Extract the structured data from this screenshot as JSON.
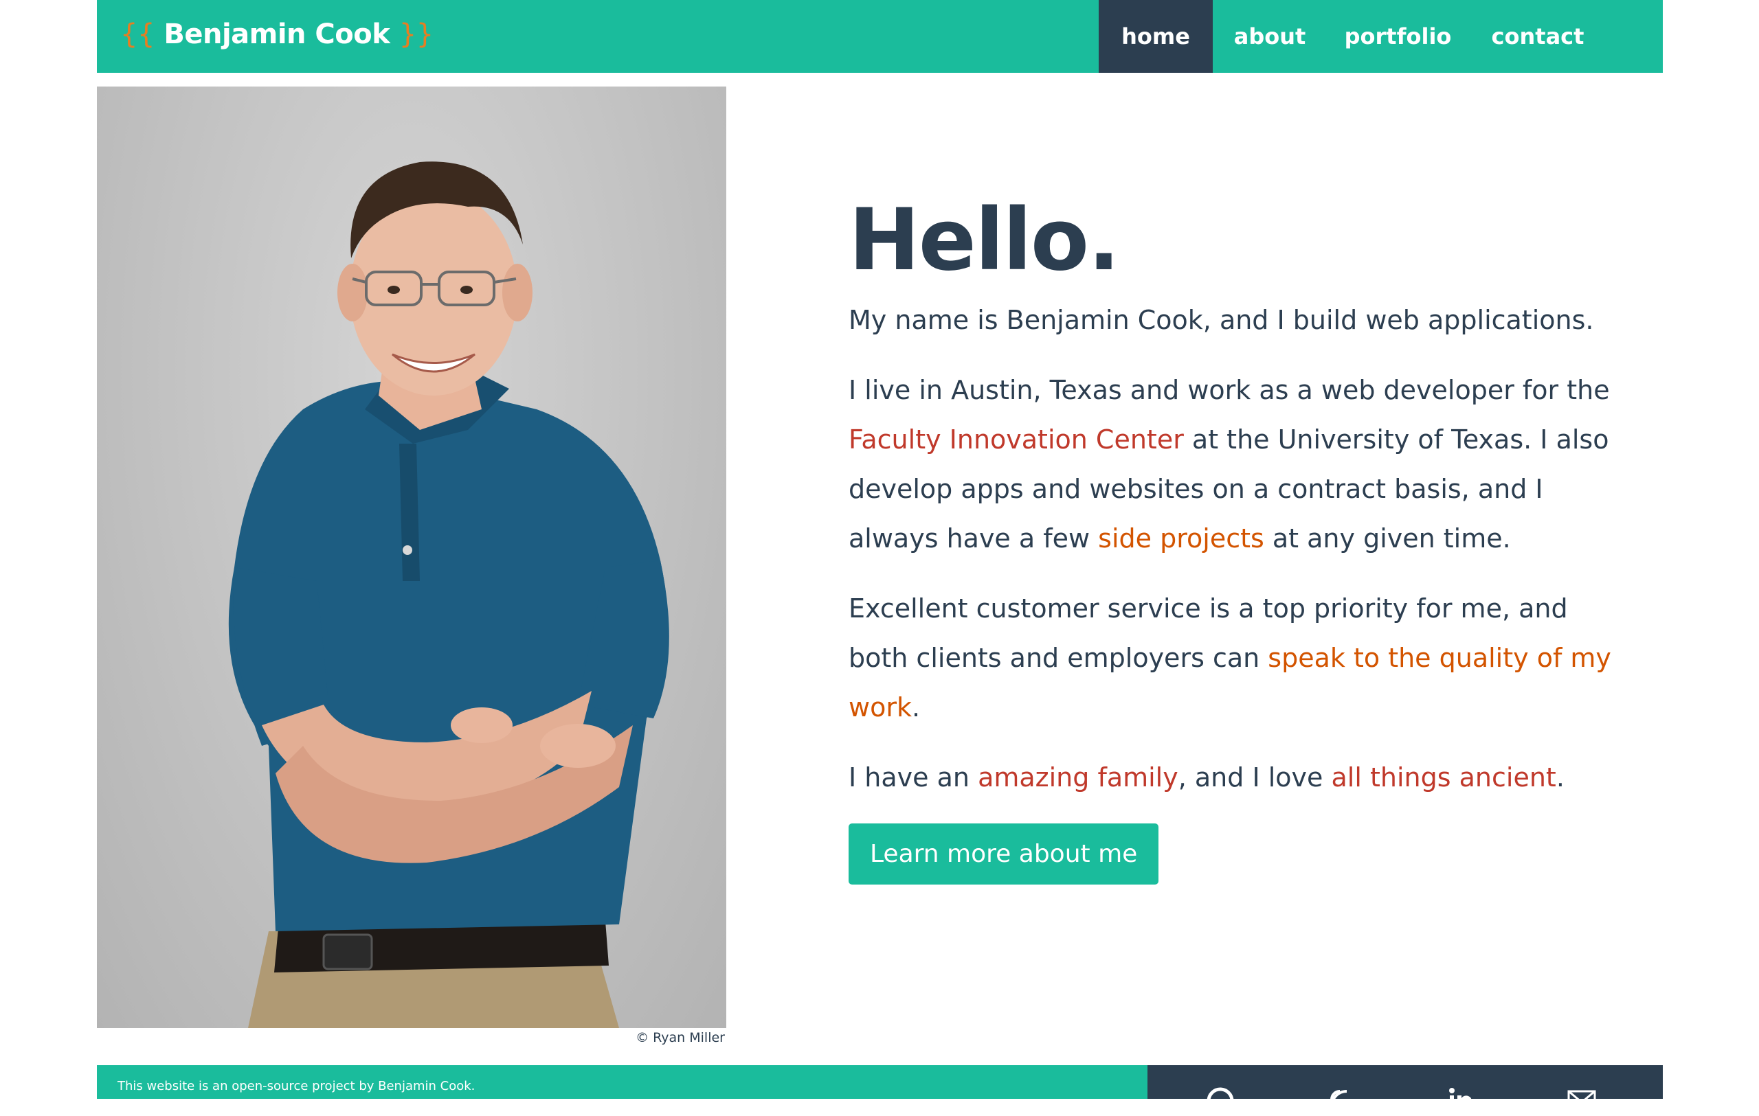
{
  "header": {
    "brand_open": "{{",
    "brand_name": "Benjamin Cook",
    "brand_close": "}}",
    "nav": {
      "home": "home",
      "about": "about",
      "portfolio": "portfolio",
      "contact": "contact"
    }
  },
  "photo": {
    "credit": "© Ryan Miller"
  },
  "intro": {
    "heading": "Hello.",
    "lead": "My name is Benjamin Cook, and I build web applications.",
    "p2_a": "I live in Austin, Texas and work as a web developer for the ",
    "p2_link1": "Faculty Innovation Center",
    "p2_b": " at the University of Texas. I also develop apps and websites on a contract basis, and I always have a few ",
    "p2_link2": "side projects",
    "p2_c": " at any given time.",
    "p3_a": "Excellent customer service is a top priority for me, and both clients and employers can ",
    "p3_link": "speak to the quality of my work",
    "p3_b": ".",
    "p4_a": "I have an ",
    "p4_link1": "amazing family",
    "p4_b": ", and I love ",
    "p4_link2": "all things ancient",
    "p4_c": ".",
    "button": "Learn more about me"
  },
  "footer": {
    "text": "This website is an open-source project by Benjamin Cook.",
    "social_icons": [
      "github-icon",
      "rss-icon",
      "linkedin-icon",
      "email-icon"
    ]
  },
  "colors": {
    "accent": "#1abc9c",
    "dark": "#2c3e50",
    "link_red": "#c0392b",
    "link_orange": "#d35400",
    "brace": "#e67e22"
  }
}
